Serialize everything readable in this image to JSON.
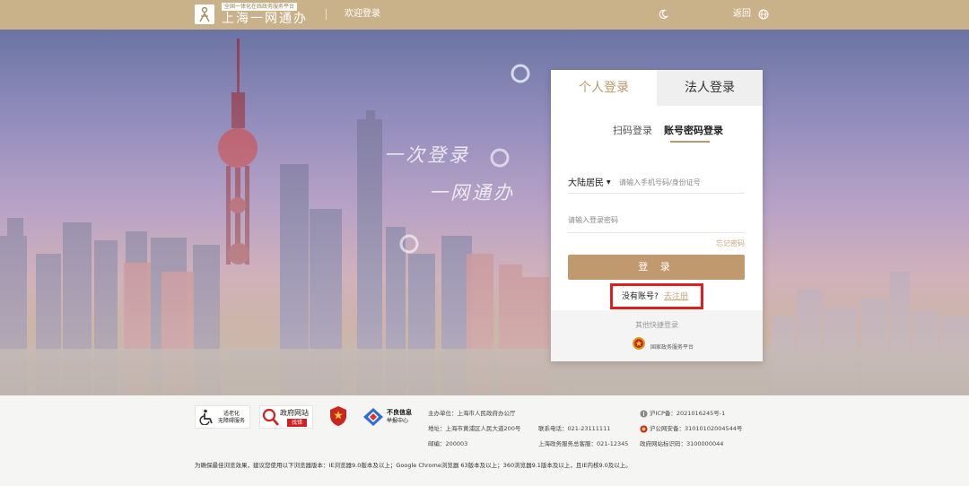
{
  "header": {
    "logo_subtitle": "全国一体化在线政务服务平台",
    "logo_title": "上海一网通办",
    "welcome": "欢迎登录",
    "back": "返回"
  },
  "hero": {
    "slogan_line1": "一次登录",
    "slogan_line2": "一网通办"
  },
  "login": {
    "tabs": {
      "personal": "个人登录",
      "legal": "法人登录"
    },
    "sub_tabs": {
      "qr": "扫码登录",
      "password": "账号密码登录",
      "active": "password"
    },
    "region": "大陆居民",
    "phone_placeholder": "请输入手机号码/身份证号",
    "password_placeholder": "请输入登录密码",
    "forgot": "忘记密码",
    "submit": "登 录",
    "no_account": "没有账号?",
    "register": "去注册",
    "other_login": "其他快捷登录",
    "national_platform": "国家政务服务平台"
  },
  "footer": {
    "badges": {
      "elderly_line1": "适老化",
      "elderly_line2": "无障碍服务",
      "errata_line1": "政府网站",
      "errata_line2": "找错",
      "report_line1": "不良信息",
      "report_line2": "举报中心"
    },
    "sponsor": "主办单位：上海市人民政府办公厅",
    "address": "地址：上海市黄浦区人民大道200号",
    "postcode": "邮编：200003",
    "phone": "联系电话：021-23111111",
    "service_hotline": "上海政务服务总客服：021-12345",
    "icp": "沪ICP备：2021016245号-1",
    "police_record": "沪公网安备：31010102004544号",
    "site_id": "政府网站标识码：3100000044",
    "browser_note": "为确保最佳浏览效果，建议您使用以下浏览器版本：IE浏览器9.0版本及以上；Google Chrome浏览器 63版本及以上；360浏览器9.1版本及以上，且IE内核9.0及以上。"
  },
  "colors": {
    "header_bg": "#c9b28a",
    "accent_gold": "#c09a6e",
    "link_gold": "#c9a87a",
    "highlight_red": "#e01e1e"
  }
}
